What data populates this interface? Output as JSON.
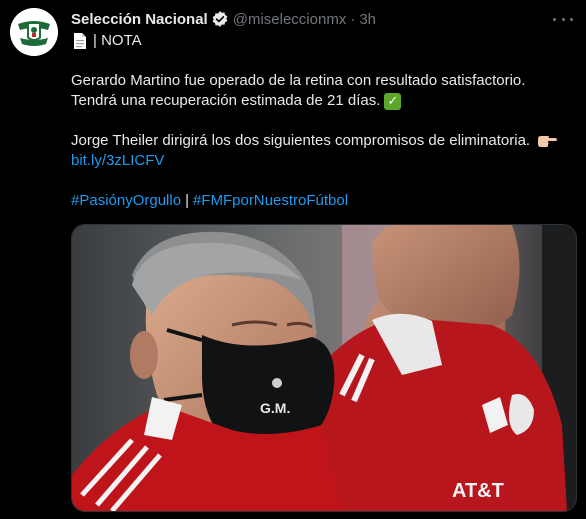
{
  "tweet": {
    "name": "Selección Nacional",
    "handle": "@miseleccionmx",
    "separator": "·",
    "time": "3h",
    "note_label": "| NOTA",
    "line1": "Gerardo Martino fue operado de la retina con resultado satisfactorio.",
    "line2": "Tendrá una recuperación estimada de 21 días.",
    "check_glyph": "✓",
    "line3": "Jorge Theiler dirigirá los dos siguientes compromisos de eliminatoria.",
    "link": "bit.ly/3zLICFV",
    "hashtag1": "#PasiónyOrgullo",
    "hashtag_sep": "|",
    "hashtag2": "#FMFporNuestroFútbol",
    "mask_text": "G.M.",
    "shirt_sponsor": "AT&T"
  },
  "icons": {
    "avatar": "federation-crest-icon",
    "verified": "verified-badge-icon",
    "more": "more-options-icon",
    "document": "page-facing-up-icon",
    "check": "check-mark-button-icon",
    "pointing": "backhand-index-pointing-right-icon"
  },
  "colors": {
    "background": "#000000",
    "text": "#e7e9ea",
    "secondary": "#71767b",
    "link": "#1d9bf0",
    "check": "#5ba82a"
  }
}
